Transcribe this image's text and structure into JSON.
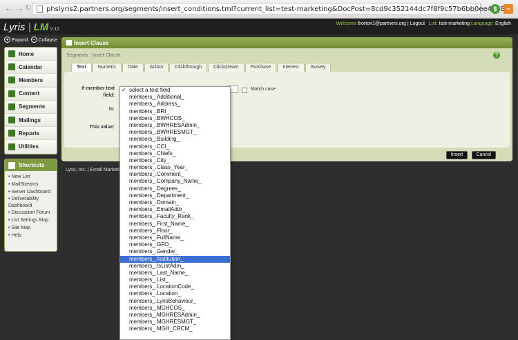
{
  "browser": {
    "url": "phslyris2.partners.org/segments/insert_conditions.tml?current_list=test-marketing&DocPost=8cd9c352144dc7f8f9c57b6bb0ee4758"
  },
  "header": {
    "logo_text": "Lyris",
    "logo_lm": "LM",
    "version": "V.12",
    "welcome_label": "Welcome",
    "user": "lhorton1@partners.org",
    "separator": "|",
    "logout": "Logout",
    "list_label": "List:",
    "list_name": "test-marketing",
    "language_label": "Language:",
    "language": "English"
  },
  "expand_collapse": {
    "expand": "Expand",
    "collapse": "Collapse"
  },
  "sidebar": {
    "items": [
      {
        "label": "Home",
        "icon": "home-icon"
      },
      {
        "label": "Calendar",
        "icon": "calendar-icon"
      },
      {
        "label": "Members",
        "icon": "members-icon"
      },
      {
        "label": "Content",
        "icon": "content-icon"
      },
      {
        "label": "Segments",
        "icon": "segments-icon"
      },
      {
        "label": "Mailings",
        "icon": "mailings-icon"
      },
      {
        "label": "Reports",
        "icon": "reports-icon"
      },
      {
        "label": "Utilities",
        "icon": "utilities-icon"
      }
    ]
  },
  "shortcuts": {
    "title": "Shortcuts",
    "items": [
      "New List",
      "MailStreams",
      "Server Dashboard",
      "Deliverability Dashboard",
      "Discussion Forum",
      "List Settings Map",
      "Site Map",
      "Help"
    ]
  },
  "panel": {
    "title": "Insert Clause",
    "breadcrumb": "Segments : Insert Clause",
    "tabs": [
      "Text",
      "Numeric",
      "Date",
      "Action",
      "Clickthrough",
      "Clickstream",
      "Purchase",
      "Interest",
      "Survey"
    ],
    "active_tab": "Text",
    "labels": {
      "if_member": "If member text field:",
      "is": "Is:",
      "value": "This value:"
    },
    "match_case": "Match case",
    "insert_button": "Insert",
    "cancel_button": "Cancel"
  },
  "footer": {
    "text": "Lyris, Inc. | Email Marketing"
  },
  "dropdown": {
    "selected": "members_.Institution_",
    "options": [
      "select a text field",
      "members_.Additional_",
      "members_.Address_",
      "members_.BRI_",
      "members_.BWHCOS_",
      "members_.BWHRESAdmin_",
      "members_.BWHRESMGT_",
      "members_.Building_",
      "members_.CCI_",
      "members_.Chiefs_",
      "members_.City_",
      "members_.Class_Year_",
      "members_.Comment_",
      "members_.Company_Name_",
      "members_.Degrees_",
      "members_.Department_",
      "members_.Domain_",
      "members_.EmailAddr_",
      "members_.Faculty_Rank_",
      "members_.First_Name_",
      "members_.Floor_",
      "members_.FullName_",
      "members_.GFO_",
      "members_.Gender_",
      "members_.Institution_",
      "members_.IsListAdm_",
      "members_.Last_Name_",
      "members_.List_",
      "members_.LocationCode_",
      "members_.Location_",
      "members_.LyrisBehaviour_",
      "members_.MGHCOS_",
      "members_.MGHRESAdmin_",
      "members_.MGHRESMGT_",
      "members_.MGH_CRCM_"
    ],
    "checked": "select a text field"
  },
  "colors": {
    "accent": "#7e9b41",
    "header_bg": "#1f1f1f",
    "selection": "#3b6fd6"
  }
}
